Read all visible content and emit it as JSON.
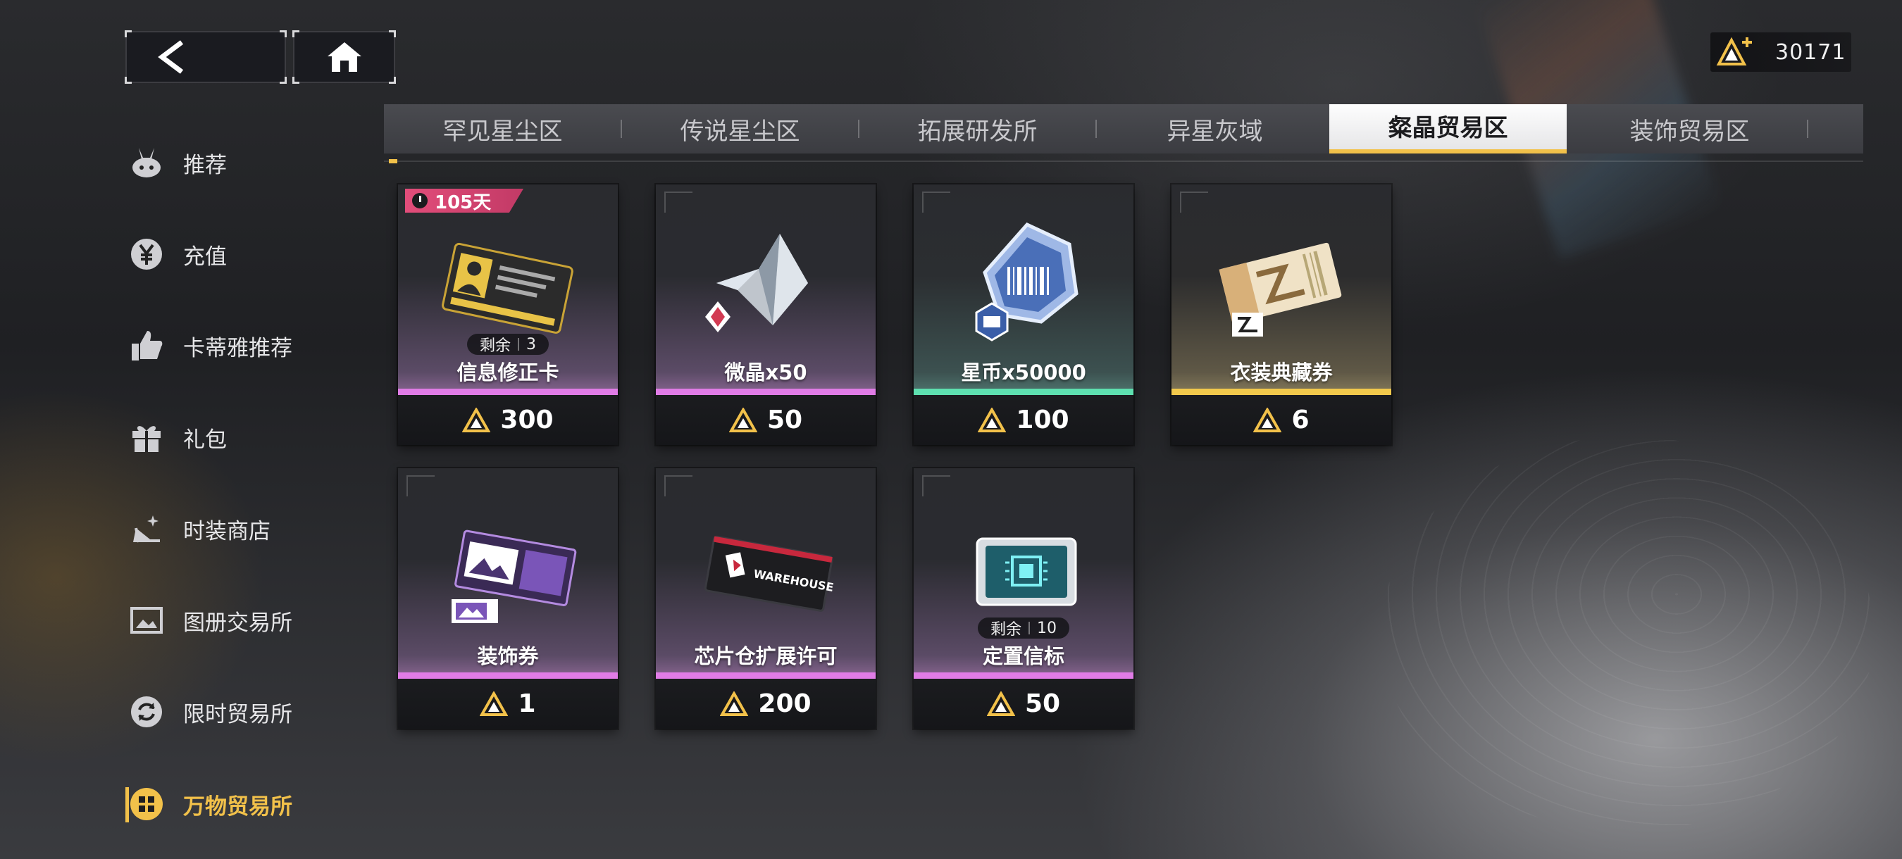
{
  "currency": {
    "value": "30171",
    "accent": "#f2c14a"
  },
  "sidebar": {
    "items": [
      {
        "label": "推荐",
        "icon": "bunny-icon"
      },
      {
        "label": "充值",
        "icon": "yen-icon"
      },
      {
        "label": "卡蒂雅推荐",
        "icon": "thumbs-up-icon"
      },
      {
        "label": "礼包",
        "icon": "gift-icon"
      },
      {
        "label": "时装商店",
        "icon": "heel-shoe-icon"
      },
      {
        "label": "图册交易所",
        "icon": "album-icon"
      },
      {
        "label": "限时贸易所",
        "icon": "refresh-icon"
      },
      {
        "label": "万物贸易所",
        "icon": "grid-icon",
        "active": true
      }
    ]
  },
  "tabs": [
    {
      "label": "罕见星尘区"
    },
    {
      "label": "传说星尘区"
    },
    {
      "label": "拓展研发所"
    },
    {
      "label": "异星灰域"
    },
    {
      "label": "粲晶贸易区",
      "active": true
    },
    {
      "label": "装饰贸易区"
    }
  ],
  "items": [
    {
      "name": "信息修正卡",
      "price": "300",
      "remain_label": "剩余",
      "remain": "3",
      "timer": "105天",
      "rarity": "purple"
    },
    {
      "name": "微晶x50",
      "price": "50",
      "rarity": "purple"
    },
    {
      "name": "星币x50000",
      "price": "100",
      "rarity": "green"
    },
    {
      "name": "衣装典藏券",
      "price": "6",
      "rarity": "gold"
    },
    {
      "name": "装饰券",
      "price": "1",
      "rarity": "purple"
    },
    {
      "name": "芯片仓扩展许可",
      "price": "200",
      "rarity": "purple",
      "brand": "WAREHOUSE"
    },
    {
      "name": "定置信标",
      "price": "50",
      "remain_label": "剩余",
      "remain": "10",
      "rarity": "purple"
    }
  ]
}
